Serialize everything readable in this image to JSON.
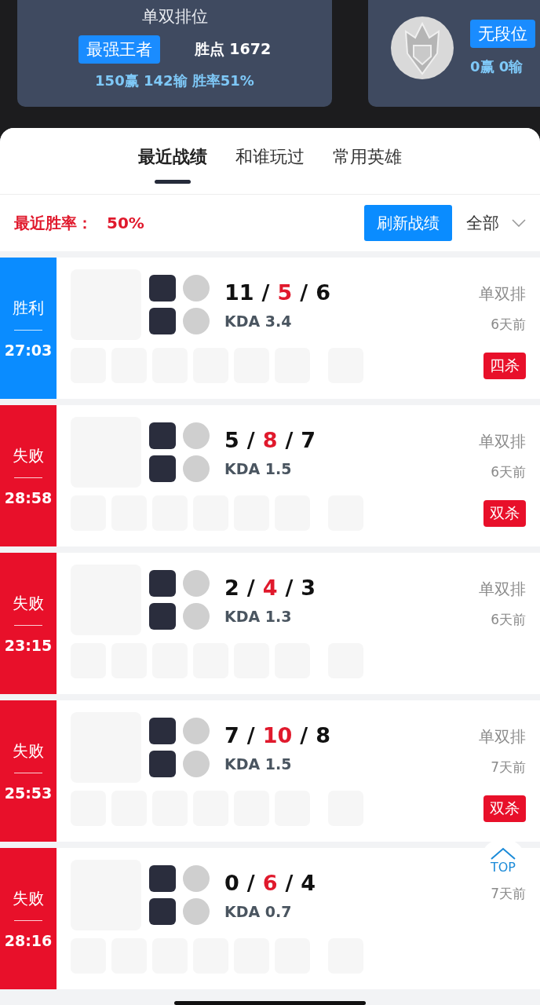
{
  "rank_cards": [
    {
      "kind": "ranked",
      "title": "单双排位",
      "tier": "最强王者",
      "points_label": "胜点",
      "points": "1672",
      "wins": "150赢",
      "losses": "142输",
      "winrate": "胜率51%"
    },
    {
      "kind": "emblem",
      "tier": "无段位",
      "wins": "0赢",
      "losses": "0输"
    }
  ],
  "tabs": [
    {
      "label": "最近战绩",
      "selected": true
    },
    {
      "label": "和谁玩过",
      "selected": false
    },
    {
      "label": "常用英雄",
      "selected": false
    }
  ],
  "summary": {
    "label": "最近胜率：",
    "value": "50%",
    "refresh_button": "刷新战绩",
    "filter": "全部"
  },
  "matches": [
    {
      "kind": "win",
      "result": "胜利",
      "duration": "27:03",
      "kills": "11",
      "deaths": "5",
      "assists": "6",
      "kda": "KDA 3.4",
      "mode": "单双排",
      "ago": "6天前",
      "badge": "四杀"
    },
    {
      "kind": "loss",
      "result": "失败",
      "duration": "28:58",
      "kills": "5",
      "deaths": "8",
      "assists": "7",
      "kda": "KDA 1.5",
      "mode": "单双排",
      "ago": "6天前",
      "badge": "双杀"
    },
    {
      "kind": "loss",
      "result": "失败",
      "duration": "23:15",
      "kills": "2",
      "deaths": "4",
      "assists": "3",
      "kda": "KDA 1.3",
      "mode": "单双排",
      "ago": "6天前"
    },
    {
      "kind": "loss",
      "result": "失败",
      "duration": "25:53",
      "kills": "7",
      "deaths": "10",
      "assists": "8",
      "kda": "KDA 1.5",
      "mode": "单双排",
      "ago": "7天前",
      "badge": "双杀"
    },
    {
      "kind": "loss",
      "result": "失败",
      "duration": "28:16",
      "kills": "0",
      "deaths": "6",
      "assists": "4",
      "kda": "KDA 0.7",
      "ago": "7天前"
    }
  ],
  "score_separator": "/",
  "top_button": "TOP"
}
